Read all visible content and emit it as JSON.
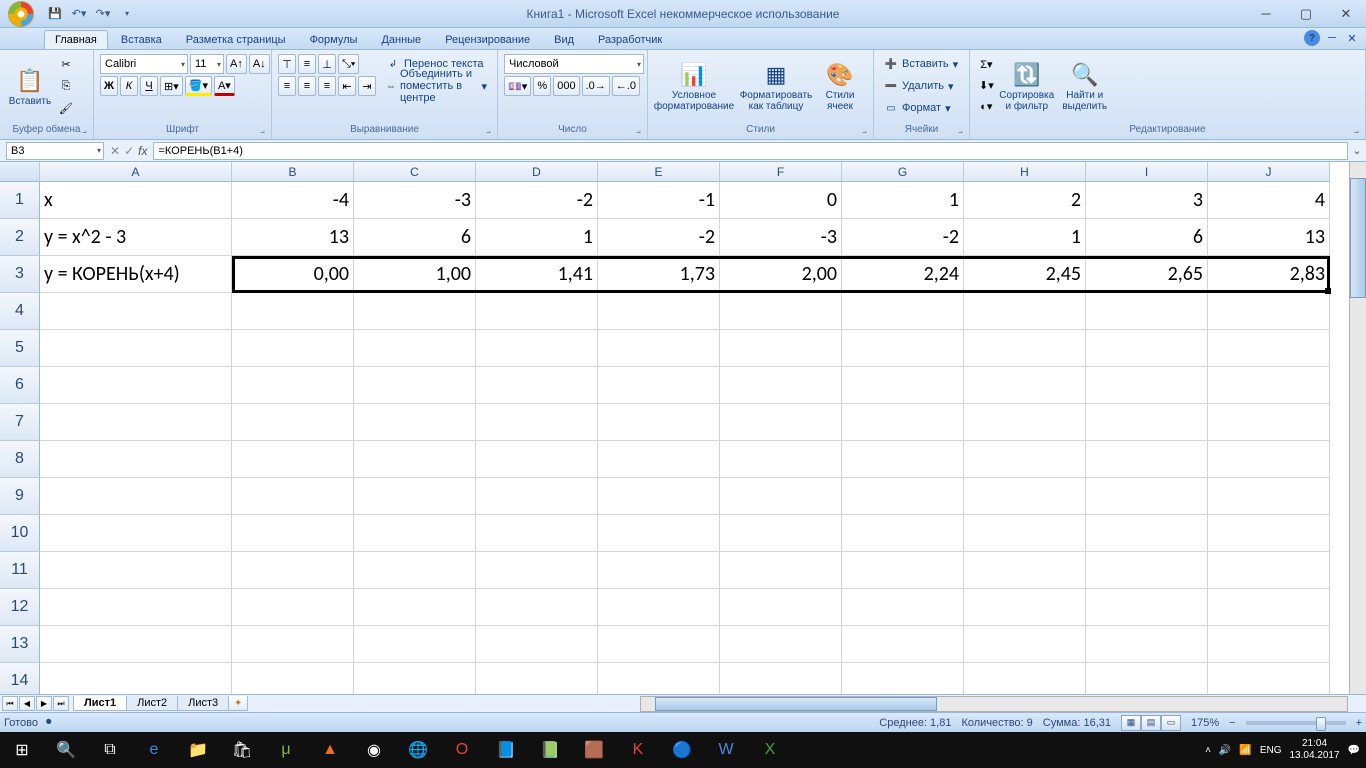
{
  "title": "Книга1 - Microsoft Excel некоммерческое использование",
  "tabs": [
    "Главная",
    "Вставка",
    "Разметка страницы",
    "Формулы",
    "Данные",
    "Рецензирование",
    "Вид",
    "Разработчик"
  ],
  "ribbon": {
    "clipboard": {
      "paste": "Вставить",
      "label": "Буфер обмена"
    },
    "font": {
      "name": "Calibri",
      "size": "11",
      "label": "Шрифт",
      "bold": "Ж",
      "italic": "К",
      "underline": "Ч"
    },
    "align": {
      "wrap": "Перенос текста",
      "merge": "Объединить и поместить в центре",
      "label": "Выравнивание"
    },
    "number": {
      "format": "Числовой",
      "label": "Число"
    },
    "styles": {
      "cond": "Условное форматирование",
      "table": "Форматировать как таблицу",
      "cell": "Стили ячеек",
      "label": "Стили"
    },
    "cells": {
      "insert": "Вставить",
      "delete": "Удалить",
      "format": "Формат",
      "label": "Ячейки"
    },
    "editing": {
      "sort": "Сортировка и фильтр",
      "find": "Найти и выделить",
      "label": "Редактирование"
    }
  },
  "namebox": "B3",
  "formula": "=КОРЕНЬ(B1+4)",
  "columns": [
    "A",
    "B",
    "C",
    "D",
    "E",
    "F",
    "G",
    "H",
    "I",
    "J"
  ],
  "rows": [
    "1",
    "2",
    "3",
    "4",
    "5",
    "6",
    "7",
    "8",
    "9",
    "10",
    "11",
    "12",
    "13",
    "14"
  ],
  "data": {
    "A1": "x",
    "B1": "-4",
    "C1": "-3",
    "D1": "-2",
    "E1": "-1",
    "F1": "0",
    "G1": "1",
    "H1": "2",
    "I1": "3",
    "J1": "4",
    "A2": "y = x^2 - 3",
    "B2": "13",
    "C2": "6",
    "D2": "1",
    "E2": "-2",
    "F2": "-3",
    "G2": "-2",
    "H2": "1",
    "I2": "6",
    "J2": "13",
    "A3": "y = КОРЕНЬ(x+4)",
    "B3": "0,00",
    "C3": "1,00",
    "D3": "1,41",
    "E3": "1,73",
    "F3": "2,00",
    "G3": "2,24",
    "H3": "2,45",
    "I3": "2,65",
    "J3": "2,83"
  },
  "sheets": [
    "Лист1",
    "Лист2",
    "Лист3"
  ],
  "status": {
    "ready": "Готово",
    "avg": "Среднее: 1,81",
    "count": "Количество: 9",
    "sum": "Сумма: 16,31",
    "zoom": "175%"
  },
  "taskbar": {
    "lang": "ENG",
    "time": "21:04",
    "date": "13.04.2017"
  }
}
